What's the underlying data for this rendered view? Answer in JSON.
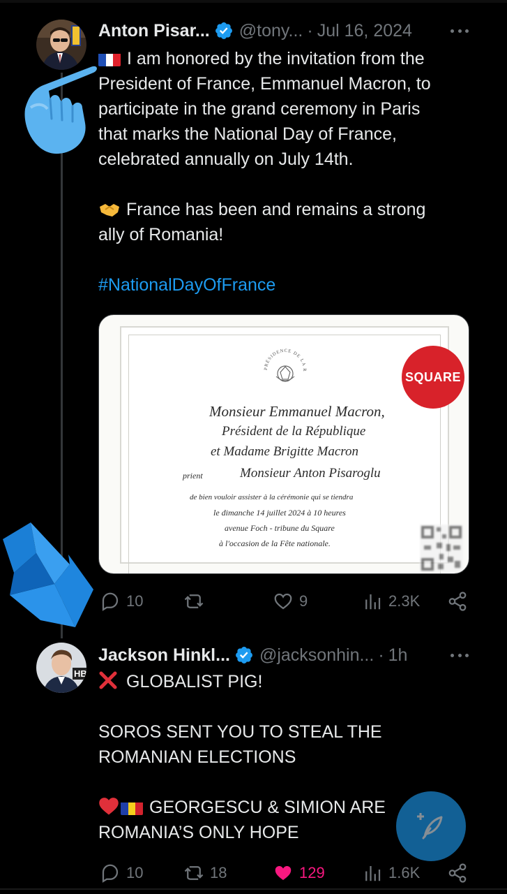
{
  "tweet1": {
    "name": "Anton Pisar...",
    "handle": "@tony...",
    "time": "Jul 16, 2024",
    "text_lines": [
      "I am honored by the invitation from the",
      "President of France, Emmanuel Macron, to",
      "participate in the grand ceremony in Paris",
      "that marks the National Day of France,",
      "celebrated annually on July 14th."
    ],
    "text2_lines": [
      "France has been and remains a strong",
      "ally of Romania!"
    ],
    "hashtag": "#NationalDayOfFrance",
    "media": {
      "badge": "SQUARE",
      "seal_text": "PRÉSIDENCE DE LA RÉPUBLIQUE",
      "invitation_lines": [
        "Monsieur Emmanuel Macron,",
        "Président de la République",
        "et Madame Brigitte Macron",
        "prient",
        "Monsieur Anton Pisaroglu",
        "de bien vouloir assister à la cérémonie qui se tiendra",
        "le dimanche 14 juillet 2024 à 10 heures",
        "avenue Foch - tribune du Square",
        "à l'occasion de la Fête nationale."
      ]
    },
    "stats": {
      "replies": "10",
      "reposts": "",
      "likes": "9",
      "views": "2.3K"
    }
  },
  "tweet2": {
    "name": "Jackson Hinkl...",
    "handle": "@jacksonhin...",
    "time": "1h",
    "line1": "GLOBALIST PIG!",
    "line2": "SOROS SENT YOU TO STEAL THE",
    "line3": "ROMANIAN ELECTIONS",
    "line4": "GEORGESCU & SIMION ARE",
    "line5": "ROMANIA’S ONLY HOPE",
    "avatar_badge": "HB",
    "stats": {
      "replies": "10",
      "reposts": "18",
      "likes": "129",
      "views": "1.6K"
    }
  },
  "colors": {
    "accent": "#1d9bf0",
    "like": "#f91880",
    "muted": "#71767b",
    "badge_red": "#d8222a"
  },
  "icons": [
    "verified-icon",
    "more-icon",
    "reply-icon",
    "repost-icon",
    "like-icon",
    "views-icon",
    "share-icon",
    "compose-icon",
    "pointing-hand-emoji",
    "bluesky-logo"
  ]
}
